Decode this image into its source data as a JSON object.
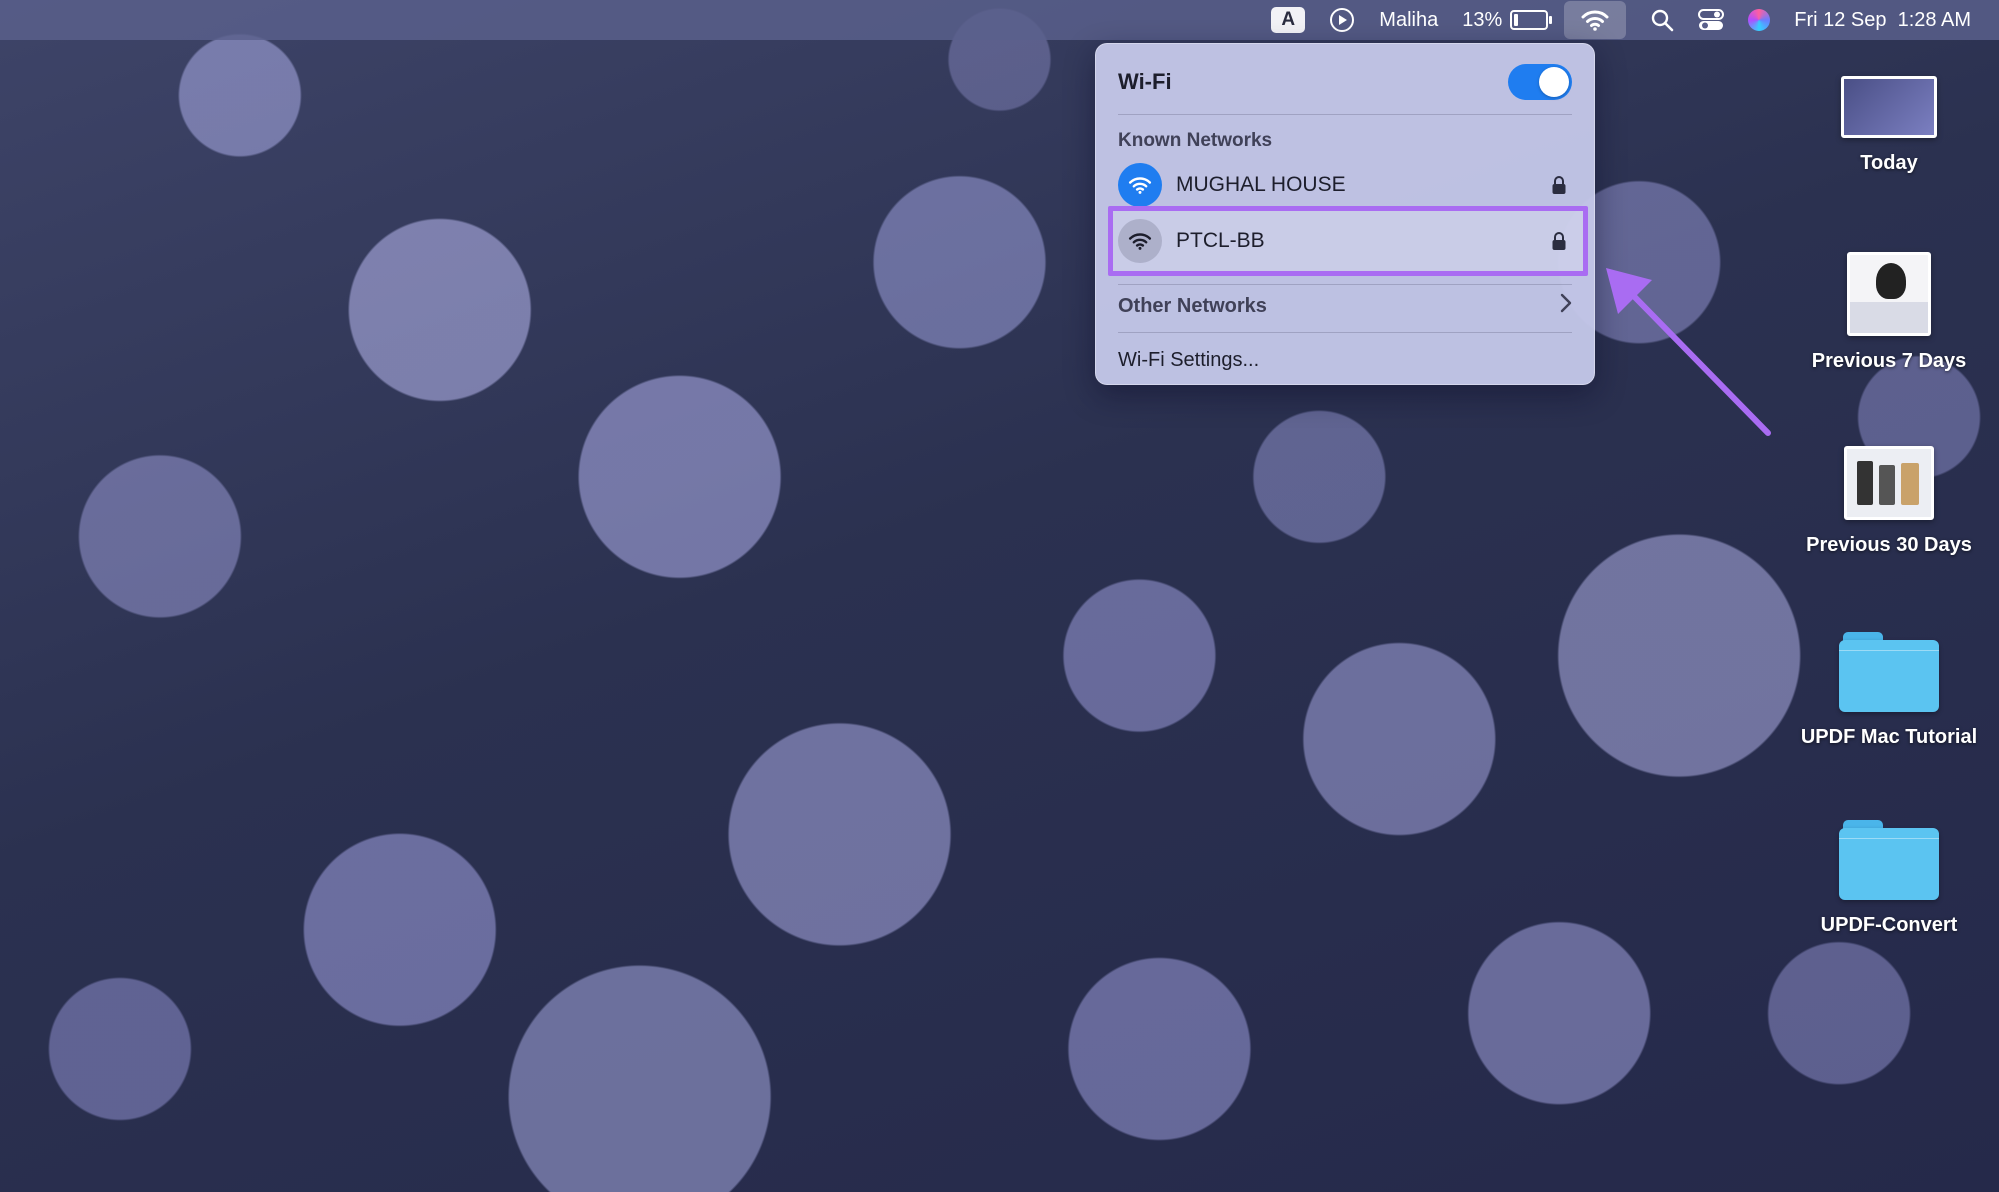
{
  "menubar": {
    "input_source": "A",
    "user_name": "Maliha",
    "battery_percent": "13%",
    "battery_level": 0.13,
    "datetime": "Fri 12 Sep  1:28 AM"
  },
  "wifi_panel": {
    "title": "Wi-Fi",
    "toggle_on": true,
    "known_networks_label": "Known Networks",
    "networks": [
      {
        "name": "MUGHAL HOUSE",
        "connected": true,
        "locked": true
      },
      {
        "name": "PTCL-BB",
        "connected": false,
        "locked": true,
        "highlighted": true
      }
    ],
    "other_networks_label": "Other Networks",
    "settings_label": "Wi-Fi Settings..."
  },
  "desktop": {
    "items": [
      {
        "label": "Today",
        "kind": "screenshot-stack"
      },
      {
        "label": "Previous 7 Days",
        "kind": "screenshot-stack"
      },
      {
        "label": "Previous 30 Days",
        "kind": "screenshot-stack"
      },
      {
        "label": "UPDF Mac Tutorial",
        "kind": "folder"
      },
      {
        "label": "UPDF-Convert",
        "kind": "folder"
      }
    ]
  },
  "colors": {
    "accent_blue": "#1f7df0",
    "highlight_purple": "#a96cf2",
    "folder_blue": "#5bc4f1"
  }
}
